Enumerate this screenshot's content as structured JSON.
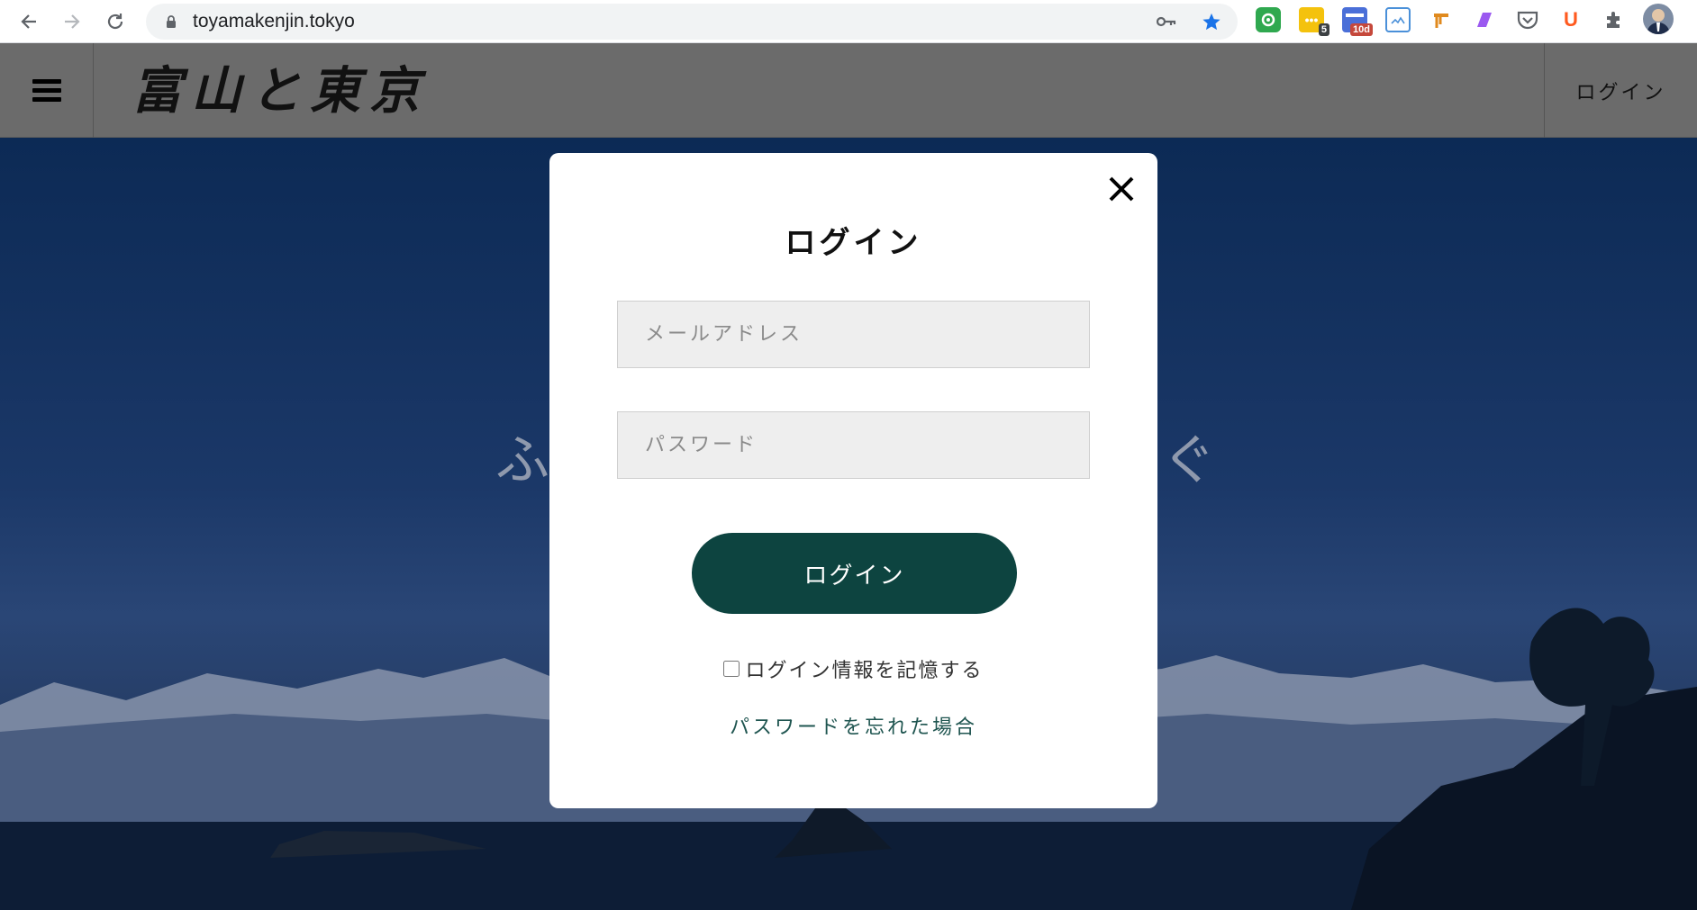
{
  "browser": {
    "url": "toyamakenjin.tokyo",
    "extensions": [
      {
        "icon": "green-circle-ext-icon",
        "color": "#2fa84f"
      },
      {
        "icon": "chat-ext-icon",
        "color": "#f4c20d",
        "badge": "5"
      },
      {
        "icon": "calendar-ext-icon",
        "color": "#4a6fd8",
        "badge": "10d"
      },
      {
        "icon": "screenshot-ext-icon",
        "color": "#4a90d9"
      },
      {
        "icon": "brush-ext-icon",
        "color": "#e08a1e"
      },
      {
        "icon": "purple-ext-icon",
        "color": "#9b59f0"
      },
      {
        "icon": "pocket-ext-icon",
        "color": "#5f6368"
      },
      {
        "icon": "u-ext-icon",
        "color": "#ff5a1f",
        "letter": "U"
      }
    ]
  },
  "header": {
    "logo_text": "富山と東京",
    "login_label": "ログイン"
  },
  "hero": {
    "tagline_left": "ふ",
    "tagline_right": "ぐ"
  },
  "modal": {
    "title": "ログイン",
    "email_placeholder": "メールアドレス",
    "password_placeholder": "パスワード",
    "submit_label": "ログイン",
    "remember_label": "ログイン情報を記憶する",
    "forgot_label": "パスワードを忘れた場合"
  },
  "colors": {
    "button": "#0d4440",
    "header_bg": "#6b6b6b",
    "link": "#1f5550"
  }
}
